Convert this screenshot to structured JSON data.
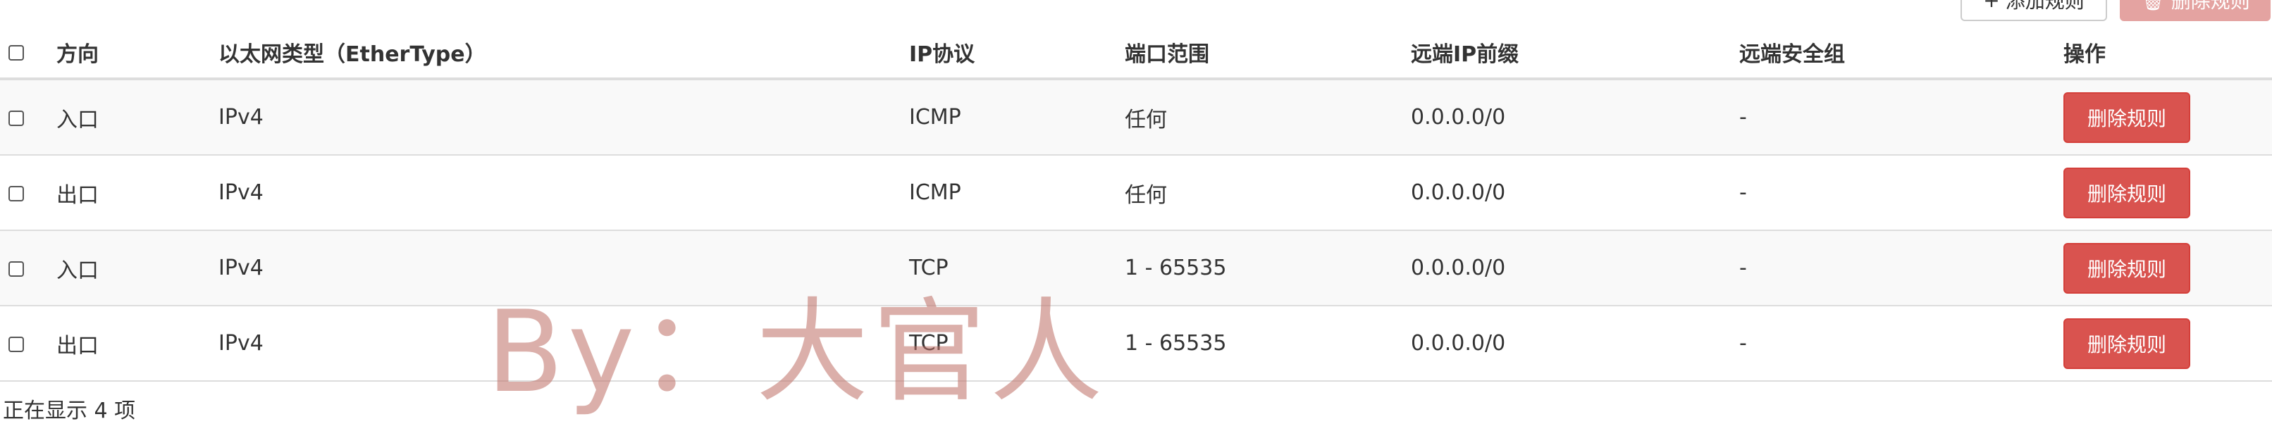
{
  "toolbar": {
    "add_label": "添加规则",
    "delete_label": "删除规则"
  },
  "table": {
    "headers": {
      "direction": "方向",
      "ethertype": "以太网类型（EtherType）",
      "protocol": "IP协议",
      "port_range": "端口范围",
      "remote_ip": "远端IP前缀",
      "remote_group": "远端安全组",
      "actions": "操作"
    },
    "rows": [
      {
        "direction": "入口",
        "ethertype": "IPv4",
        "protocol": "ICMP",
        "port_range": "任何",
        "remote_ip": "0.0.0.0/0",
        "remote_group": "-",
        "action_label": "删除规则"
      },
      {
        "direction": "出口",
        "ethertype": "IPv4",
        "protocol": "ICMP",
        "port_range": "任何",
        "remote_ip": "0.0.0.0/0",
        "remote_group": "-",
        "action_label": "删除规则"
      },
      {
        "direction": "入口",
        "ethertype": "IPv4",
        "protocol": "TCP",
        "port_range": "1 - 65535",
        "remote_ip": "0.0.0.0/0",
        "remote_group": "-",
        "action_label": "删除规则"
      },
      {
        "direction": "出口",
        "ethertype": "IPv4",
        "protocol": "TCP",
        "port_range": "1 - 65535",
        "remote_ip": "0.0.0.0/0",
        "remote_group": "-",
        "action_label": "删除规则"
      }
    ]
  },
  "footer": {
    "count_text": "正在显示 4 项"
  },
  "watermark": {
    "text": "By：大官人"
  },
  "colors": {
    "danger": "#d9534f",
    "danger_disabled": "#e4a3a1",
    "watermark": "#be6e64"
  }
}
